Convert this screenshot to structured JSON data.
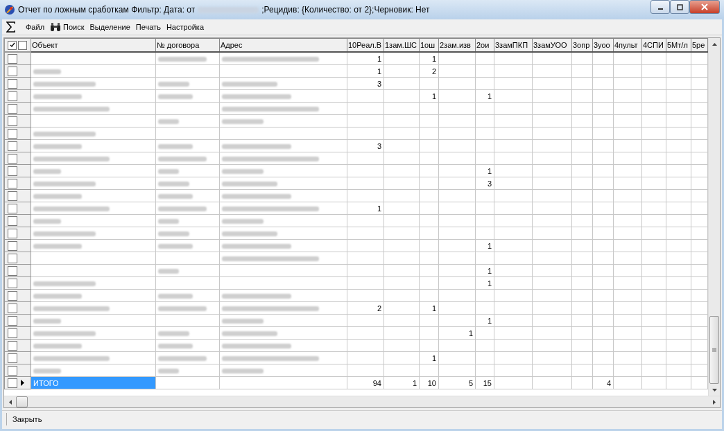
{
  "window": {
    "title_start": "Отчет по ложным сработкам  Фильтр: Дата: от",
    "title_date_redacted": true,
    "title_end": ";Рецидив: {Количество: от 2};Черновик: Нет"
  },
  "menu": [
    {
      "label": "Файл",
      "kind": "plain"
    },
    {
      "label": "Поиск",
      "kind": "search"
    },
    {
      "label": "Выделение",
      "kind": "plain"
    },
    {
      "label": "Печать",
      "kind": "plain"
    },
    {
      "label": "Настройка",
      "kind": "plain"
    }
  ],
  "header_checks": [
    {
      "checked": true
    },
    {
      "checked": false
    }
  ],
  "columns": [
    "Объект",
    "№ договора",
    "Адрес",
    "10Реал.В",
    "1зам.ШС",
    "1ош",
    "2зам.изв",
    "2ои",
    "3замПКП",
    "3замУОО",
    "3опр",
    "3уоо",
    "4пульт",
    "4СПИ",
    "5Мт/л",
    "5ре"
  ],
  "rows": [
    {
      "redacted": [
        false,
        true,
        true
      ],
      "cells": [
        {
          "text": "1"
        },
        {},
        {
          "text": "1"
        },
        {},
        {},
        {},
        {},
        {},
        {},
        {},
        {},
        {},
        {}
      ],
      "checked": false,
      "selected": false
    },
    {
      "redacted": [
        true,
        false,
        false
      ],
      "cells": [
        {
          "text": "1"
        },
        {},
        {
          "text": "2"
        },
        {},
        {},
        {},
        {},
        {},
        {},
        {},
        {},
        {},
        {}
      ],
      "checked": false,
      "selected": false
    },
    {
      "redacted": [
        true,
        true,
        true
      ],
      "cells": [
        {
          "text": "3"
        },
        {},
        {},
        {},
        {},
        {},
        {},
        {},
        {},
        {},
        {},
        {},
        {}
      ],
      "checked": false,
      "selected": false
    },
    {
      "redacted": [
        true,
        true,
        true
      ],
      "cells": [
        {},
        {},
        {
          "text": "1"
        },
        {},
        {
          "text": "1"
        },
        {},
        {},
        {},
        {},
        {},
        {},
        {},
        {}
      ],
      "checked": false,
      "selected": false
    },
    {
      "redacted": [
        true,
        false,
        true
      ],
      "cells": [
        {},
        {},
        {},
        {},
        {},
        {},
        {},
        {},
        {},
        {},
        {},
        {},
        {}
      ],
      "checked": false,
      "selected": false
    },
    {
      "redacted": [
        false,
        true,
        true
      ],
      "cells": [
        {},
        {},
        {},
        {},
        {},
        {},
        {},
        {},
        {},
        {},
        {},
        {},
        {}
      ],
      "checked": false,
      "selected": false
    },
    {
      "redacted": [
        true,
        false,
        false
      ],
      "cells": [
        {},
        {},
        {},
        {},
        {},
        {},
        {},
        {},
        {},
        {},
        {},
        {},
        {}
      ],
      "checked": false,
      "selected": false
    },
    {
      "redacted": [
        true,
        true,
        true
      ],
      "cells": [
        {
          "text": "3"
        },
        {},
        {},
        {},
        {},
        {},
        {},
        {},
        {},
        {},
        {},
        {},
        {}
      ],
      "checked": false,
      "selected": false
    },
    {
      "redacted": [
        true,
        true,
        true
      ],
      "cells": [
        {},
        {},
        {},
        {},
        {},
        {},
        {},
        {},
        {},
        {},
        {},
        {},
        {}
      ],
      "checked": false,
      "selected": false
    },
    {
      "redacted": [
        true,
        true,
        true
      ],
      "cells": [
        {},
        {},
        {},
        {},
        {
          "text": "1"
        },
        {},
        {},
        {},
        {},
        {},
        {},
        {},
        {}
      ],
      "checked": false,
      "selected": false
    },
    {
      "redacted": [
        true,
        true,
        true
      ],
      "cells": [
        {},
        {},
        {},
        {},
        {
          "text": "3"
        },
        {},
        {},
        {},
        {},
        {},
        {},
        {},
        {}
      ],
      "checked": false,
      "selected": false
    },
    {
      "redacted": [
        true,
        true,
        true
      ],
      "cells": [
        {},
        {},
        {},
        {},
        {},
        {},
        {},
        {},
        {},
        {},
        {},
        {},
        {}
      ],
      "checked": false,
      "selected": false
    },
    {
      "redacted": [
        true,
        true,
        true
      ],
      "cells": [
        {
          "text": "1"
        },
        {},
        {},
        {},
        {},
        {},
        {},
        {},
        {},
        {},
        {},
        {},
        {}
      ],
      "checked": false,
      "selected": false
    },
    {
      "redacted": [
        true,
        true,
        true
      ],
      "cells": [
        {},
        {},
        {},
        {},
        {},
        {},
        {},
        {},
        {},
        {},
        {},
        {},
        {}
      ],
      "checked": false,
      "selected": false
    },
    {
      "redacted": [
        true,
        true,
        true
      ],
      "cells": [
        {},
        {},
        {},
        {},
        {},
        {},
        {},
        {},
        {},
        {},
        {},
        {},
        {}
      ],
      "checked": false,
      "selected": false
    },
    {
      "redacted": [
        true,
        true,
        true
      ],
      "cells": [
        {},
        {},
        {},
        {},
        {
          "text": "1"
        },
        {},
        {},
        {},
        {},
        {},
        {},
        {},
        {}
      ],
      "checked": false,
      "selected": false
    },
    {
      "redacted": [
        false,
        false,
        true
      ],
      "cells": [
        {},
        {},
        {},
        {},
        {},
        {},
        {},
        {},
        {},
        {},
        {},
        {},
        {}
      ],
      "checked": false,
      "selected": false
    },
    {
      "redacted": [
        false,
        true,
        false
      ],
      "cells": [
        {},
        {},
        {},
        {},
        {
          "text": "1"
        },
        {},
        {},
        {},
        {},
        {},
        {},
        {},
        {}
      ],
      "checked": false,
      "selected": false
    },
    {
      "redacted": [
        true,
        false,
        false
      ],
      "cells": [
        {},
        {},
        {},
        {},
        {
          "text": "1"
        },
        {},
        {},
        {},
        {},
        {},
        {},
        {},
        {}
      ],
      "checked": false,
      "selected": false
    },
    {
      "redacted": [
        true,
        true,
        true
      ],
      "cells": [
        {},
        {},
        {},
        {},
        {},
        {},
        {},
        {},
        {},
        {},
        {},
        {},
        {}
      ],
      "checked": false,
      "selected": false
    },
    {
      "redacted": [
        true,
        true,
        true
      ],
      "cells": [
        {
          "text": "2"
        },
        {},
        {
          "text": "1"
        },
        {},
        {},
        {},
        {},
        {},
        {},
        {},
        {},
        {},
        {}
      ],
      "checked": false,
      "selected": false
    },
    {
      "redacted": [
        true,
        false,
        true
      ],
      "cells": [
        {},
        {},
        {},
        {},
        {
          "text": "1"
        },
        {},
        {},
        {},
        {},
        {},
        {},
        {},
        {}
      ],
      "checked": false,
      "selected": false
    },
    {
      "redacted": [
        true,
        true,
        true
      ],
      "cells": [
        {},
        {},
        {},
        {
          "text": "1"
        },
        {},
        {},
        {},
        {},
        {},
        {},
        {},
        {},
        {}
      ],
      "checked": false,
      "selected": false
    },
    {
      "redacted": [
        true,
        true,
        true
      ],
      "cells": [
        {},
        {},
        {},
        {},
        {},
        {},
        {},
        {},
        {},
        {},
        {},
        {},
        {}
      ],
      "checked": false,
      "selected": false
    },
    {
      "redacted": [
        true,
        true,
        true
      ],
      "cells": [
        {},
        {},
        {
          "text": "1"
        },
        {},
        {},
        {},
        {},
        {},
        {},
        {},
        {},
        {},
        {}
      ],
      "checked": false,
      "selected": false
    },
    {
      "redacted": [
        true,
        true,
        true
      ],
      "cells": [
        {},
        {},
        {},
        {},
        {},
        {},
        {},
        {},
        {},
        {},
        {},
        {},
        {}
      ],
      "checked": false,
      "selected": false
    },
    {
      "label": "ИТОГО",
      "redacted": [
        false,
        false,
        false
      ],
      "cells": [
        {
          "text": "94"
        },
        {
          "text": "1"
        },
        {
          "text": "10"
        },
        {
          "text": "5"
        },
        {
          "text": "15"
        },
        {},
        {},
        {},
        {
          "text": "4"
        },
        {},
        {},
        {},
        {}
      ],
      "checked": false,
      "selected": true
    }
  ],
  "footer": {
    "button": "Закрыть"
  }
}
